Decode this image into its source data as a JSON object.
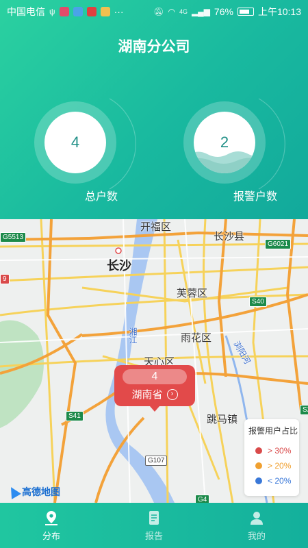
{
  "status_bar": {
    "carrier": "中国电信",
    "extra": "···",
    "network": "4G",
    "battery": "76%",
    "time": "上午10:13"
  },
  "header": {
    "title": "湖南分公司"
  },
  "stats": {
    "total": {
      "value": "4",
      "label": "总户数"
    },
    "alarm": {
      "value": "2",
      "label": "报警户数"
    }
  },
  "map": {
    "labels": {
      "kaifu": "开福区",
      "changshaxian": "长沙县",
      "changsha": "长沙",
      "furong": "芙蓉区",
      "yuhua": "雨花区",
      "tianxin": "天心区",
      "tiaoma": "跳马镇",
      "xiangjiang": "湘江",
      "liuyanghe": "浏阳河"
    },
    "roads": [
      "G5513",
      "G6021",
      "S40",
      "S41",
      "G107",
      "G4",
      "S2",
      "9"
    ],
    "bubble": {
      "count": "4",
      "name": "湖南省",
      "arrow": "›"
    },
    "legend": {
      "title": "报警用户占比",
      "items": [
        {
          "label": "> 30%",
          "color": "#d94a4a"
        },
        {
          "label": "> 20%",
          "color": "#f0a030"
        },
        {
          "label": "< 20%",
          "color": "#3a78d8"
        }
      ]
    },
    "logo": "高德地图"
  },
  "tabs": [
    {
      "label": "分布",
      "icon": "map-pin-icon",
      "active": true
    },
    {
      "label": "报告",
      "icon": "report-icon",
      "active": false
    },
    {
      "label": "我的",
      "icon": "user-icon",
      "active": false
    }
  ]
}
